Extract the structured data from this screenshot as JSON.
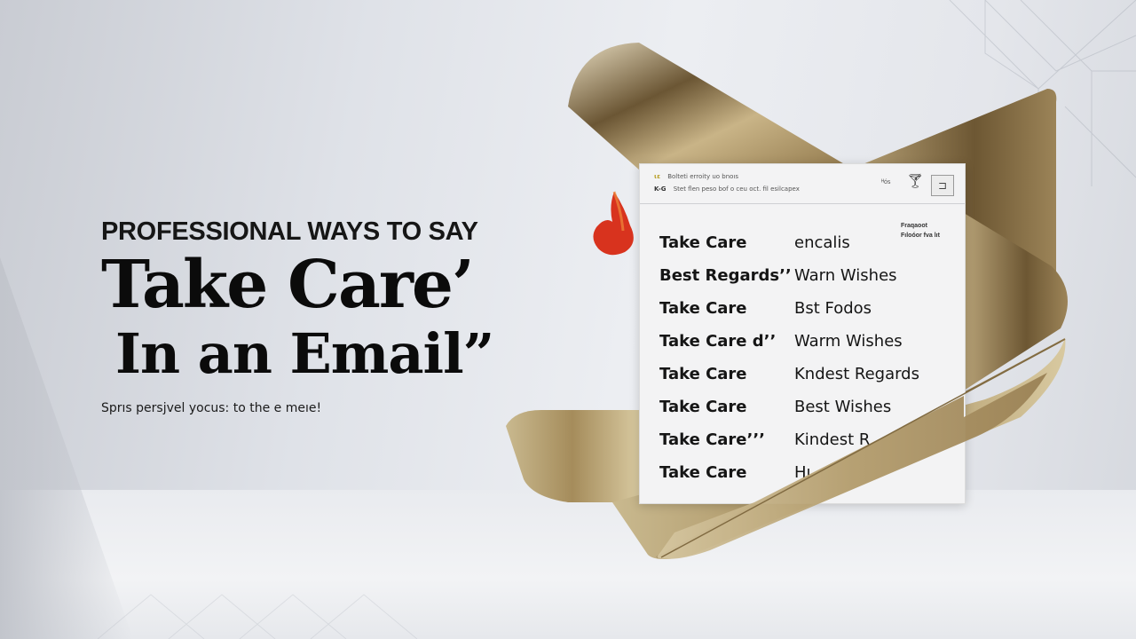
{
  "hero": {
    "kicker": "PROFESSIONAL WAYS TO SAY",
    "title_line1": "Take Care’",
    "title_line2": "In an Email”",
    "subtitle": "Sprıs persjvel yocus: to the e meıe!"
  },
  "email_card": {
    "header": {
      "meta_line1_icon": "ɩɛ",
      "meta_line1": "Bolteti erroity uo bnoıs",
      "meta_line2_icon": "K-G",
      "meta_line2": "Stet flen peso bof o ceu oct. fil esilcapex",
      "count": "ᴴóꜱ",
      "glass_icon": "wine-glass-icon",
      "action_icon": "reply-box-icon"
    },
    "side_note": [
      "Fraqaoot",
      "Fıloóor fva lıt"
    ],
    "rows": [
      {
        "left": "Take Care",
        "right": "encalis"
      },
      {
        "left": "Best Regards’’",
        "right": "Warn Wishes"
      },
      {
        "left": "Take Care",
        "right": "Bst Fodos"
      },
      {
        "left": "Take Care d’’",
        "right": "Warm Wishes"
      },
      {
        "left": "Take Care",
        "right": "Kndest Regards"
      },
      {
        "left": "Take Care",
        "right": "Best Wishes"
      },
      {
        "left": "Take Care’’’",
        "right": "Kindest R"
      },
      {
        "left": "Take Care",
        "right": "Hı"
      }
    ]
  },
  "decor": {
    "sculpture": "gold-ribbon-sculpture",
    "petal": "red-petal",
    "colors": {
      "gold_light": "#d9c9a3",
      "gold_mid": "#a88f5e",
      "gold_dark": "#5f4b2c",
      "petal": "#d8331e"
    }
  }
}
